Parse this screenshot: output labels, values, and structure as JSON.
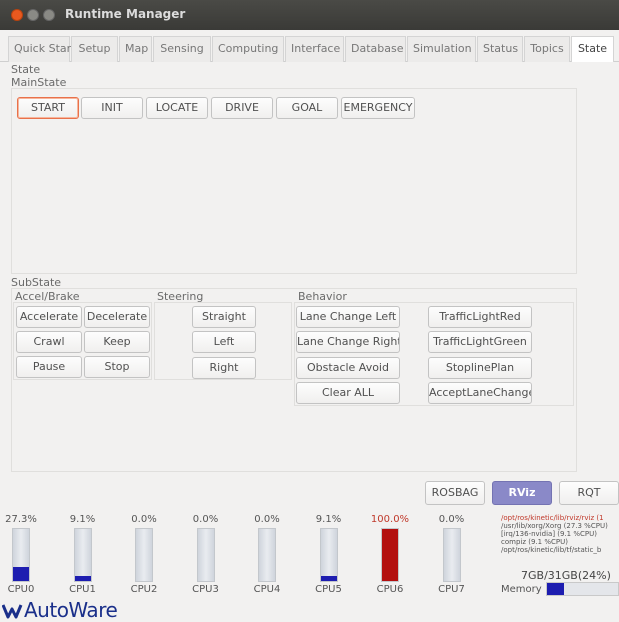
{
  "window": {
    "title": "Runtime Manager"
  },
  "tabs": [
    {
      "label": "Quick Start"
    },
    {
      "label": "Setup"
    },
    {
      "label": "Map"
    },
    {
      "label": "Sensing"
    },
    {
      "label": "Computing"
    },
    {
      "label": "Interface"
    },
    {
      "label": "Database"
    },
    {
      "label": "Simulation"
    },
    {
      "label": "Status"
    },
    {
      "label": "Topics"
    },
    {
      "label": "State",
      "active": true
    }
  ],
  "state": {
    "heading": "State",
    "main_state": {
      "label": "MainState",
      "buttons": [
        "START",
        "INIT",
        "LOCATE",
        "DRIVE",
        "GOAL",
        "EMERGENCY"
      ],
      "selected": "START"
    },
    "sub_state": {
      "label": "SubState",
      "accel_brake": {
        "label": "Accel/Brake",
        "buttons": [
          "Accelerate",
          "Decelerate",
          "Crawl",
          "Keep",
          "Pause",
          "Stop"
        ]
      },
      "steering": {
        "label": "Steering",
        "buttons": [
          "Straight",
          "Left",
          "Right"
        ]
      },
      "behavior": {
        "label": "Behavior",
        "buttons": [
          "Lane Change Left",
          "TrafficLightRed",
          "Lane Change Right",
          "TrafficLightGreen",
          "Obstacle Avoid",
          "StoplinePlan",
          "Clear ALL",
          "AcceptLaneChange"
        ]
      }
    }
  },
  "tools": {
    "rosbag": "ROSBAG",
    "rviz": "RViz",
    "rqt": "RQT"
  },
  "cpus": [
    {
      "name": "CPU0",
      "percent_label": "27.3%",
      "usage": 27.3
    },
    {
      "name": "CPU1",
      "percent_label": "9.1%",
      "usage": 9.1
    },
    {
      "name": "CPU2",
      "percent_label": "0.0%",
      "usage": 0.0
    },
    {
      "name": "CPU3",
      "percent_label": "0.0%",
      "usage": 0.0
    },
    {
      "name": "CPU4",
      "percent_label": "0.0%",
      "usage": 0.0
    },
    {
      "name": "CPU5",
      "percent_label": "9.1%",
      "usage": 9.1
    },
    {
      "name": "CPU6",
      "percent_label": "100.0%",
      "usage": 100.0,
      "alert": true
    },
    {
      "name": "CPU7",
      "percent_label": "0.0%",
      "usage": 0.0
    }
  ],
  "processes": [
    "/opt/ros/kinetic/lib/rviz/rviz (1",
    "/usr/lib/xorg/Xorg (27.3 %CPU)",
    "[irq/136-nvidia] (9.1 %CPU)",
    "compiz (9.1 %CPU)",
    "/opt/ros/kinetic/lib/tf/static_b"
  ],
  "memory": {
    "label": "Memory",
    "usage_text": "7GB/31GB(24%)",
    "usage": 24
  },
  "logo": {
    "text": "AutoWare"
  },
  "colors": {
    "cpu_bar": "#1d1db0",
    "cpu_alert": "#b31010",
    "rviz_button": "#8a89c8",
    "selected_border": "#e9714a"
  }
}
